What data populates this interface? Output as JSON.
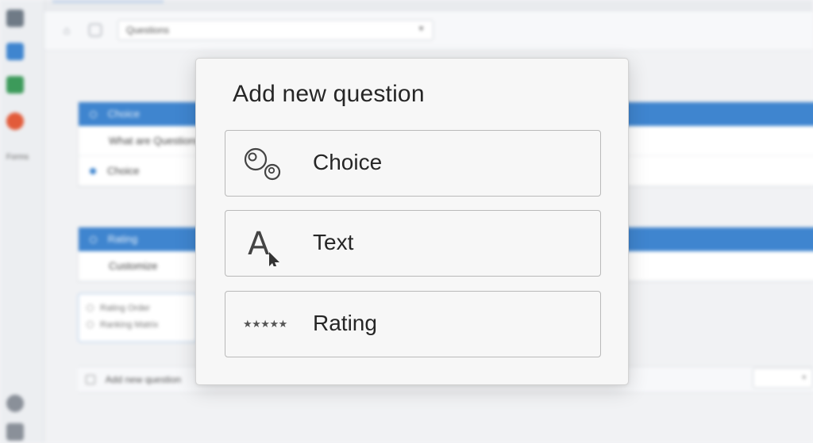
{
  "background": {
    "rail_label": "Forms",
    "toolbar": {
      "select_value": "Questions"
    },
    "sections": [
      {
        "header": "Choice",
        "rows": [
          "What are Questions",
          "Choice"
        ]
      },
      {
        "header": "Rating",
        "rows": [
          "Customize"
        ]
      }
    ],
    "options_preview": [
      "Rating Order",
      "Ranking Matrix"
    ],
    "add_row_label": "Add new question"
  },
  "dialog": {
    "title": "Add new question",
    "options": [
      {
        "label": "Choice",
        "icon": "choice-bubbles-icon"
      },
      {
        "label": "Text",
        "icon": "text-cursor-icon"
      },
      {
        "label": "Rating",
        "icon": "rating-stars-icon"
      }
    ],
    "rating_glyph": "★★★★★"
  },
  "colors": {
    "accent": "#3f85cf",
    "dialog_bg": "#f7f7f7",
    "option_border": "#b9b9b9"
  }
}
